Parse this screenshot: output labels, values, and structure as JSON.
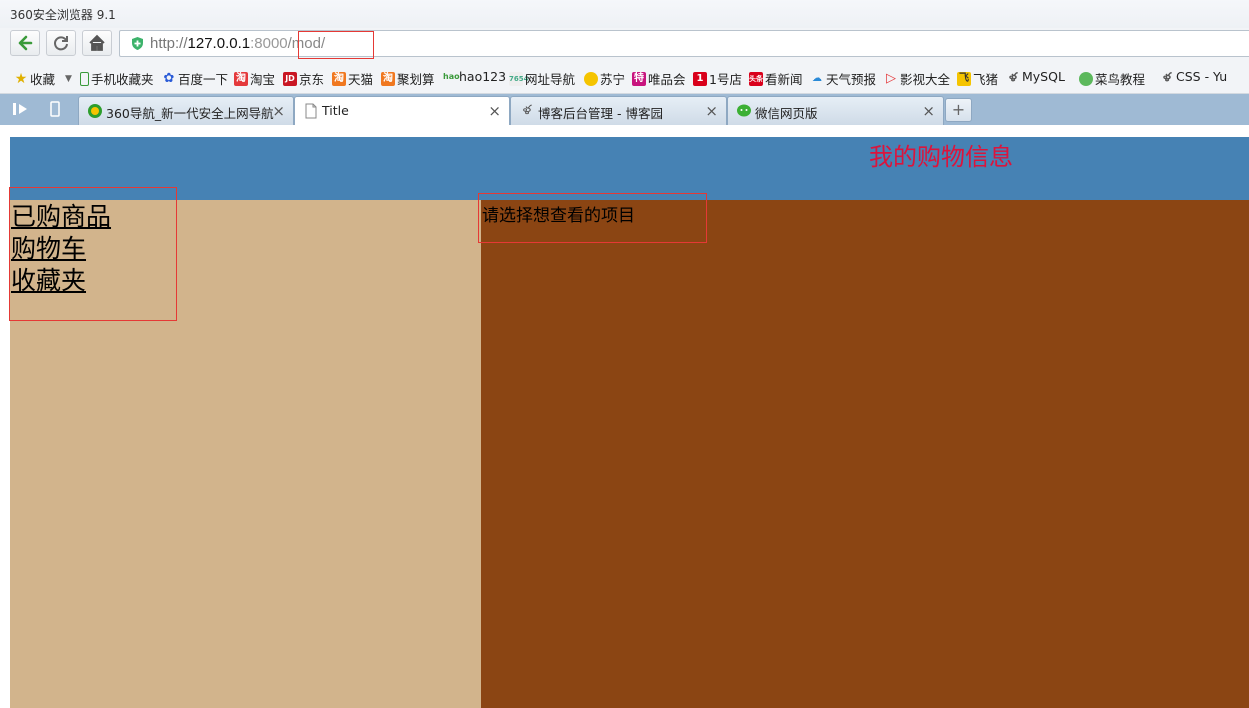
{
  "window": {
    "title": "360安全浏览器 9.1"
  },
  "address_bar": {
    "scheme": "http://",
    "host": "127.0.0.1",
    "port": ":8000",
    "path": "/mod/"
  },
  "bookmarks": [
    {
      "label": "收藏",
      "icon": "star-icon"
    },
    {
      "label": "手机收藏夹",
      "icon": "phone-icon"
    },
    {
      "label": "百度一下",
      "icon": "baidu-icon"
    },
    {
      "label": "淘宝",
      "icon": "taobao-icon"
    },
    {
      "label": "京东",
      "icon": "jd-icon"
    },
    {
      "label": "天猫",
      "icon": "tmall-icon"
    },
    {
      "label": "聚划算",
      "icon": "juhuasuan-icon"
    },
    {
      "label": "hao123",
      "icon": "hao123-icon"
    },
    {
      "label": "网址导航",
      "icon": "nav-site-icon"
    },
    {
      "label": "苏宁",
      "icon": "suning-icon"
    },
    {
      "label": "唯品会",
      "icon": "vip-icon"
    },
    {
      "label": "1号店",
      "icon": "yhd-icon"
    },
    {
      "label": "看新闻",
      "icon": "news-icon"
    },
    {
      "label": "天气预报",
      "icon": "weather-icon"
    },
    {
      "label": "影视大全",
      "icon": "video-icon"
    },
    {
      "label": "飞猪",
      "icon": "fliggy-icon"
    },
    {
      "label": "MySQL",
      "icon": "cnblogs-icon"
    },
    {
      "label": "菜鸟教程",
      "icon": "runoob-icon"
    },
    {
      "label": "CSS - Yu",
      "icon": "cnblogs-icon"
    }
  ],
  "tabs": [
    {
      "label": "360导航_新一代安全上网导航",
      "close": "×",
      "icon": "360-icon"
    },
    {
      "label": "Title",
      "close": "×",
      "icon": "page-icon",
      "active": true
    },
    {
      "label": "博客后台管理 - 博客园",
      "close": "×",
      "icon": "cnblogs-icon"
    },
    {
      "label": "微信网页版",
      "close": "×",
      "icon": "wechat-icon"
    }
  ],
  "new_tab": "+",
  "page": {
    "header_title": "我的购物信息",
    "menu": [
      "已购商品",
      "购物车",
      "收藏夹"
    ],
    "prompt": "请选择想查看的项目",
    "colors": {
      "header": "#4682b4",
      "title": "#dc143c",
      "sidebar": "#d2b48c",
      "main": "#8b4513",
      "highlight_box": "#e53935"
    }
  }
}
